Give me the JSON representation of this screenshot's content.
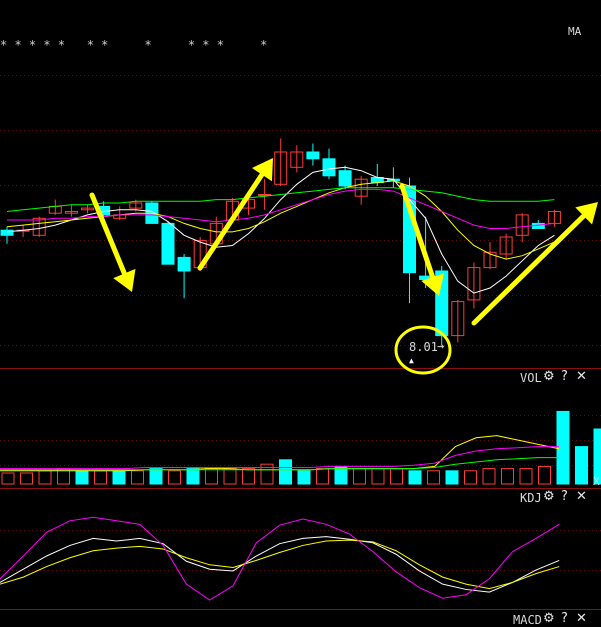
{
  "indicator_tag": "MA",
  "event_markers": "* * * * *   * *     *     * * *     *",
  "low_price_label": "8.01",
  "panels": {
    "vol": {
      "label": "VOL"
    },
    "kdj": {
      "label": "KDJ"
    },
    "macd": {
      "label": "MACD"
    }
  },
  "controls": {
    "settings_icon": "gear-icon",
    "help_label": "?",
    "close_label": "✕"
  },
  "edge_mark": "X",
  "colors": {
    "background": "#000000",
    "up_candle": "#ff3a3a",
    "down_candle": "#00ffff",
    "ma5": "#ffffff",
    "ma10": "#ffff00",
    "ma20": "#ff00ff",
    "ma60": "#00ff00",
    "annotation": "#ffff00",
    "grid": "#7a1010"
  },
  "chart_data": {
    "type": "candlestick",
    "candles": [
      {
        "o": 0.44,
        "h": 0.46,
        "l": 0.36,
        "c": 0.41
      },
      {
        "o": 0.44,
        "h": 0.47,
        "l": 0.4,
        "c": 0.44
      },
      {
        "o": 0.41,
        "h": 0.52,
        "l": 0.4,
        "c": 0.51
      },
      {
        "o": 0.54,
        "h": 0.62,
        "l": 0.53,
        "c": 0.58
      },
      {
        "o": 0.54,
        "h": 0.59,
        "l": 0.52,
        "c": 0.55
      },
      {
        "o": 0.56,
        "h": 0.59,
        "l": 0.54,
        "c": 0.57
      },
      {
        "o": 0.58,
        "h": 0.61,
        "l": 0.51,
        "c": 0.53
      },
      {
        "o": 0.51,
        "h": 0.58,
        "l": 0.5,
        "c": 0.53
      },
      {
        "o": 0.57,
        "h": 0.62,
        "l": 0.55,
        "c": 0.6
      },
      {
        "o": 0.6,
        "h": 0.61,
        "l": 0.48,
        "c": 0.48
      },
      {
        "o": 0.48,
        "h": 0.49,
        "l": 0.24,
        "c": 0.24
      },
      {
        "o": 0.28,
        "h": 0.3,
        "l": 0.04,
        "c": 0.2
      },
      {
        "o": 0.22,
        "h": 0.4,
        "l": 0.2,
        "c": 0.38
      },
      {
        "o": 0.36,
        "h": 0.52,
        "l": 0.34,
        "c": 0.48
      },
      {
        "o": 0.5,
        "h": 0.63,
        "l": 0.49,
        "c": 0.61
      },
      {
        "o": 0.57,
        "h": 0.64,
        "l": 0.53,
        "c": 0.62
      },
      {
        "o": 0.65,
        "h": 0.74,
        "l": 0.56,
        "c": 0.65
      },
      {
        "o": 0.71,
        "h": 0.98,
        "l": 0.7,
        "c": 0.9
      },
      {
        "o": 0.81,
        "h": 0.94,
        "l": 0.78,
        "c": 0.9
      },
      {
        "o": 0.9,
        "h": 0.95,
        "l": 0.82,
        "c": 0.86
      },
      {
        "o": 0.86,
        "h": 0.92,
        "l": 0.74,
        "c": 0.76
      },
      {
        "o": 0.79,
        "h": 0.82,
        "l": 0.68,
        "c": 0.7
      },
      {
        "o": 0.64,
        "h": 0.76,
        "l": 0.59,
        "c": 0.74
      },
      {
        "o": 0.75,
        "h": 0.83,
        "l": 0.7,
        "c": 0.72
      },
      {
        "o": 0.74,
        "h": 0.81,
        "l": 0.69,
        "c": 0.73
      },
      {
        "o": 0.7,
        "h": 0.75,
        "l": 0.01,
        "c": 0.19
      },
      {
        "o": 0.17,
        "h": 0.52,
        "l": 0.1,
        "c": 0.15
      },
      {
        "o": 0.2,
        "h": 0.23,
        "l": -0.24,
        "c": -0.18
      },
      {
        "o": -0.18,
        "h": 0.03,
        "l": -0.22,
        "c": 0.02
      },
      {
        "o": 0.03,
        "h": 0.25,
        "l": -0.02,
        "c": 0.22
      },
      {
        "o": 0.22,
        "h": 0.37,
        "l": 0.21,
        "c": 0.31
      },
      {
        "o": 0.3,
        "h": 0.42,
        "l": 0.27,
        "c": 0.4
      },
      {
        "o": 0.41,
        "h": 0.54,
        "l": 0.37,
        "c": 0.53
      },
      {
        "o": 0.48,
        "h": 0.5,
        "l": 0.45,
        "c": 0.45
      },
      {
        "o": 0.48,
        "h": 0.56,
        "l": 0.46,
        "c": 0.55
      }
    ],
    "ma": [
      {
        "name": "MA5",
        "values": [
          0.43,
          0.44,
          0.45,
          0.47,
          0.5,
          0.53,
          0.55,
          0.56,
          0.56,
          0.55,
          0.49,
          0.41,
          0.37,
          0.34,
          0.35,
          0.42,
          0.51,
          0.62,
          0.71,
          0.78,
          0.8,
          0.81,
          0.79,
          0.75,
          0.74,
          0.62,
          0.51,
          0.3,
          0.14,
          0.07,
          0.1,
          0.17,
          0.26,
          0.35,
          0.41
        ]
      },
      {
        "name": "MA10",
        "values": [
          0.46,
          0.47,
          0.48,
          0.49,
          0.5,
          0.51,
          0.52,
          0.53,
          0.54,
          0.54,
          0.52,
          0.48,
          0.45,
          0.43,
          0.43,
          0.45,
          0.49,
          0.54,
          0.58,
          0.62,
          0.66,
          0.69,
          0.71,
          0.72,
          0.73,
          0.7,
          0.64,
          0.55,
          0.44,
          0.35,
          0.3,
          0.27,
          0.29,
          0.33,
          0.37
        ]
      },
      {
        "name": "MA20",
        "values": [
          0.5,
          0.5,
          0.5,
          0.51,
          0.51,
          0.52,
          0.52,
          0.53,
          0.53,
          0.53,
          0.52,
          0.51,
          0.5,
          0.49,
          0.5,
          0.51,
          0.53,
          0.56,
          0.59,
          0.62,
          0.65,
          0.67,
          0.68,
          0.68,
          0.67,
          0.63,
          0.59,
          0.55,
          0.51,
          0.47,
          0.45,
          0.45,
          0.46,
          0.47,
          0.48
        ]
      },
      {
        "name": "MA60",
        "values": [
          0.55,
          0.56,
          0.57,
          0.58,
          0.59,
          0.59,
          0.6,
          0.6,
          0.61,
          0.61,
          0.61,
          0.61,
          0.61,
          0.62,
          0.62,
          0.63,
          0.64,
          0.65,
          0.66,
          0.67,
          0.68,
          0.69,
          0.69,
          0.69,
          0.69,
          0.68,
          0.67,
          0.66,
          0.64,
          0.62,
          0.61,
          0.61,
          0.61,
          0.61,
          0.62
        ]
      }
    ],
    "volume": [
      0.1,
      0.1,
      0.12,
      0.14,
      0.12,
      0.12,
      0.12,
      0.12,
      0.14,
      0.12,
      0.14,
      0.14,
      0.14,
      0.14,
      0.18,
      0.22,
      0.12,
      0.14,
      0.16,
      0.14,
      0.14,
      0.14,
      0.12,
      0.12,
      0.12,
      0.12,
      0.14,
      0.14,
      0.14,
      0.16,
      0.66,
      0.34,
      0.5,
      0.26,
      0.2,
      0.22,
      0.22,
      0.26,
      0.24,
      0.18,
      0.22
    ],
    "kdj": [
      {
        "name": "K",
        "values": [
          0.2,
          0.35,
          0.5,
          0.62,
          0.7,
          0.67,
          0.7,
          0.64,
          0.44,
          0.35,
          0.33,
          0.5,
          0.64,
          0.7,
          0.72,
          0.69,
          0.65,
          0.52,
          0.33,
          0.18,
          0.12,
          0.09,
          0.2,
          0.34,
          0.45
        ]
      },
      {
        "name": "D",
        "values": [
          0.18,
          0.26,
          0.38,
          0.48,
          0.56,
          0.59,
          0.61,
          0.58,
          0.48,
          0.4,
          0.37,
          0.45,
          0.54,
          0.62,
          0.67,
          0.68,
          0.66,
          0.56,
          0.4,
          0.26,
          0.18,
          0.13,
          0.2,
          0.3,
          0.38
        ]
      },
      {
        "name": "J",
        "values": [
          0.24,
          0.5,
          0.77,
          0.9,
          0.94,
          0.9,
          0.86,
          0.62,
          0.18,
          0.0,
          0.16,
          0.65,
          0.85,
          0.92,
          0.86,
          0.75,
          0.55,
          0.32,
          0.14,
          0.02,
          0.06,
          0.24,
          0.55,
          0.7,
          0.86
        ]
      }
    ]
  }
}
